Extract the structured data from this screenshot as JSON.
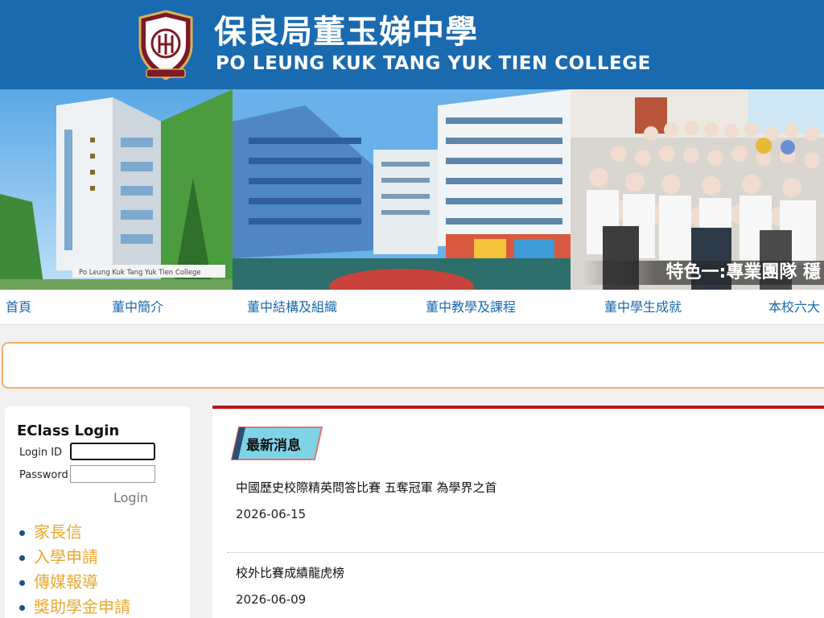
{
  "header": {
    "title_zh": "保良局董玉娣中學",
    "title_en": "PO LEUNG KUK TANG YUK TIEN COLLEGE",
    "logo_icon": "school-crest-icon"
  },
  "banner": {
    "building_sign": "Po Leung Kuk Tang Yuk Tien College",
    "caption": "特色一:專業團隊 穩"
  },
  "nav": {
    "items": [
      "首頁",
      "董中簡介",
      "董中結構及組織",
      "董中教學及課程",
      "董中學生成就",
      "本校六大"
    ]
  },
  "login": {
    "title": "EClass Login",
    "id_label": "Login ID",
    "password_label": "Password",
    "id_value": "",
    "password_value": "",
    "button": "Login"
  },
  "quick_links": [
    "家長信",
    "入學申請",
    "傳媒報導",
    "獎助學金申請"
  ],
  "news": {
    "heading": "最新消息",
    "items": [
      {
        "title": "中國歷史校際精英問答比賽 五奪冠軍 為學界之首",
        "date": "2026-06-15"
      },
      {
        "title": "校外比賽成績龍虎榜",
        "date": "2026-06-09"
      }
    ]
  },
  "colors": {
    "header_blue": "#1a6aaf",
    "nav_text": "#1a6aaf",
    "link_gold": "#e8a933",
    "news_border_red": "#c0141b",
    "strip_border_orange": "#efae6a"
  }
}
